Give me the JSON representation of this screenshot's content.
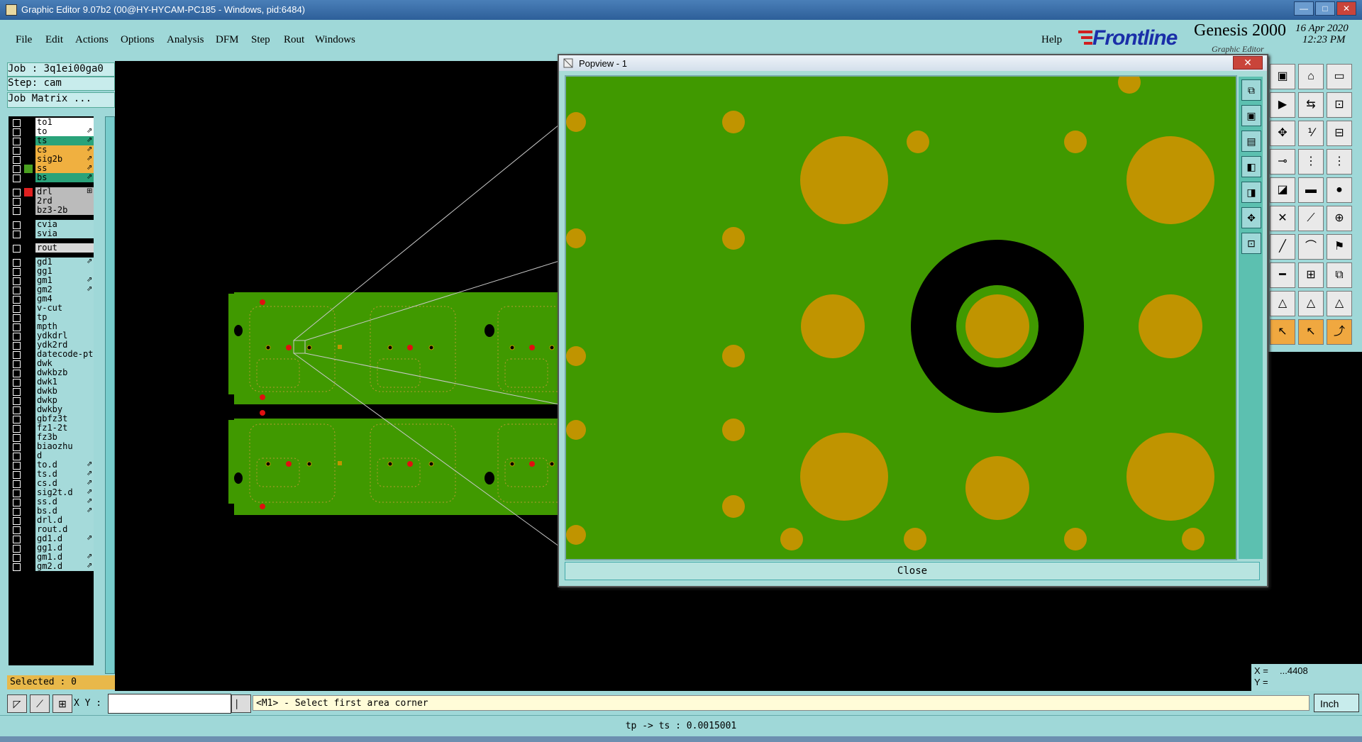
{
  "window": {
    "title": "Graphic Editor 9.07b2 (00@HY-HYCAM-PC185 - Windows, pid:6484)",
    "min_btn": "—",
    "max_btn": "□",
    "close_btn": "✕"
  },
  "menu": [
    "File",
    "Edit",
    "Actions",
    "Options",
    "Analysis",
    "DFM",
    "Step",
    "Rout",
    "Windows"
  ],
  "help_label": "Help",
  "brand": {
    "logo": "Frontline",
    "product": "Genesis 2000",
    "subtitle": "Graphic Editor",
    "date": "16 Apr 2020",
    "time": "12:23 PM"
  },
  "job": {
    "job_label": "Job : 3q1ei00ga0",
    "step_label": "Step: cam",
    "matrix_button": "Job Matrix ..."
  },
  "layers": [
    {
      "name": "to1",
      "bg": "#ffffff",
      "swatch": "",
      "flag": ""
    },
    {
      "name": "to",
      "bg": "#ffffff",
      "swatch": "",
      "flag": "⇗"
    },
    {
      "name": "ts",
      "bg": "#2aa37a",
      "swatch": "",
      "flag": "⇗"
    },
    {
      "name": "cs",
      "bg": "#f0b040",
      "swatch": "",
      "flag": "⇗"
    },
    {
      "name": "sig2b",
      "bg": "#f0b040",
      "swatch": "",
      "flag": "⇗"
    },
    {
      "name": "ss",
      "bg": "#f0b040",
      "swatch": "#4aa020",
      "flag": "⇗"
    },
    {
      "name": "bs",
      "bg": "#2aa37a",
      "swatch": "",
      "flag": "⇗"
    },
    {
      "name": "drl",
      "bg": "#bbbbbb",
      "swatch": "#e02020",
      "flag": "⊞",
      "gap": true
    },
    {
      "name": "2rd",
      "bg": "#bbbbbb",
      "swatch": "",
      "flag": ""
    },
    {
      "name": "bz3-2b",
      "bg": "#bbbbbb",
      "swatch": "",
      "flag": ""
    },
    {
      "name": "cvia",
      "bg": "#a5dada",
      "swatch": "",
      "flag": "",
      "gap": true
    },
    {
      "name": "svia",
      "bg": "#a5dada",
      "swatch": "",
      "flag": ""
    },
    {
      "name": "rout",
      "bg": "#d8d8d8",
      "swatch": "",
      "flag": "",
      "gap": true
    },
    {
      "name": "gd1",
      "bg": "#a5dada",
      "swatch": "",
      "flag": "⇗",
      "gap": true
    },
    {
      "name": "gg1",
      "bg": "#a5dada",
      "swatch": "",
      "flag": ""
    },
    {
      "name": "gm1",
      "bg": "#a5dada",
      "swatch": "",
      "flag": "⇗"
    },
    {
      "name": "gm2",
      "bg": "#a5dada",
      "swatch": "",
      "flag": "⇗"
    },
    {
      "name": "gm4",
      "bg": "#a5dada",
      "swatch": "",
      "flag": ""
    },
    {
      "name": "v-cut",
      "bg": "#a5dada",
      "swatch": "",
      "flag": ""
    },
    {
      "name": "tp",
      "bg": "#a5dada",
      "swatch": "",
      "flag": ""
    },
    {
      "name": "mpth",
      "bg": "#a5dada",
      "swatch": "",
      "flag": ""
    },
    {
      "name": "ydkdrl",
      "bg": "#a5dada",
      "swatch": "",
      "flag": ""
    },
    {
      "name": "ydk2rd",
      "bg": "#a5dada",
      "swatch": "",
      "flag": ""
    },
    {
      "name": "datecode-pt",
      "bg": "#a5dada",
      "swatch": "",
      "flag": ""
    },
    {
      "name": "dwk",
      "bg": "#a5dada",
      "swatch": "",
      "flag": ""
    },
    {
      "name": "dwkbzb",
      "bg": "#a5dada",
      "swatch": "",
      "flag": ""
    },
    {
      "name": "dwk1",
      "bg": "#a5dada",
      "swatch": "",
      "flag": ""
    },
    {
      "name": "dwkb",
      "bg": "#a5dada",
      "swatch": "",
      "flag": ""
    },
    {
      "name": "dwkp",
      "bg": "#a5dada",
      "swatch": "",
      "flag": ""
    },
    {
      "name": "dwkby",
      "bg": "#a5dada",
      "swatch": "",
      "flag": ""
    },
    {
      "name": "gbfz3t",
      "bg": "#a5dada",
      "swatch": "",
      "flag": ""
    },
    {
      "name": "fz1-2t",
      "bg": "#a5dada",
      "swatch": "",
      "flag": ""
    },
    {
      "name": "fz3b",
      "bg": "#a5dada",
      "swatch": "",
      "flag": ""
    },
    {
      "name": "biaozhu",
      "bg": "#a5dada",
      "swatch": "",
      "flag": ""
    },
    {
      "name": "d",
      "bg": "#a5dada",
      "swatch": "",
      "flag": ""
    },
    {
      "name": "to.d",
      "bg": "#a5dada",
      "swatch": "",
      "flag": "⇗"
    },
    {
      "name": "ts.d",
      "bg": "#a5dada",
      "swatch": "",
      "flag": "⇗"
    },
    {
      "name": "cs.d",
      "bg": "#a5dada",
      "swatch": "",
      "flag": "⇗"
    },
    {
      "name": "sig2t.d",
      "bg": "#a5dada",
      "swatch": "",
      "flag": "⇗"
    },
    {
      "name": "ss.d",
      "bg": "#a5dada",
      "swatch": "",
      "flag": "⇗"
    },
    {
      "name": "bs.d",
      "bg": "#a5dada",
      "swatch": "",
      "flag": "⇗"
    },
    {
      "name": "drl.d",
      "bg": "#a5dada",
      "swatch": "",
      "flag": ""
    },
    {
      "name": "rout.d",
      "bg": "#a5dada",
      "swatch": "",
      "flag": ""
    },
    {
      "name": "gd1.d",
      "bg": "#a5dada",
      "swatch": "",
      "flag": "⇗"
    },
    {
      "name": "gg1.d",
      "bg": "#a5dada",
      "swatch": "",
      "flag": ""
    },
    {
      "name": "gm1.d",
      "bg": "#a5dada",
      "swatch": "",
      "flag": "⇗"
    },
    {
      "name": "gm2.d",
      "bg": "#a5dada",
      "swatch": "",
      "flag": "⇗"
    }
  ],
  "selected_label": "Selected : 0",
  "popup": {
    "title": "Popview - 1",
    "close_x": "✕",
    "close_button": "Close"
  },
  "coords": {
    "x_label": "X =",
    "x_value": "...4408",
    "y_label": "Y ="
  },
  "command": {
    "xy_label": "X Y :",
    "xy_value": "",
    "prompt": "<M1> - Select first area corner",
    "unit": "Inch"
  },
  "status": "tp -> ts : 0.0015001",
  "colors": {
    "board_green": "#409900",
    "pad_gold": "#c09400",
    "drill_red": "#e01010",
    "panel_teal": "#9fd8d8"
  }
}
